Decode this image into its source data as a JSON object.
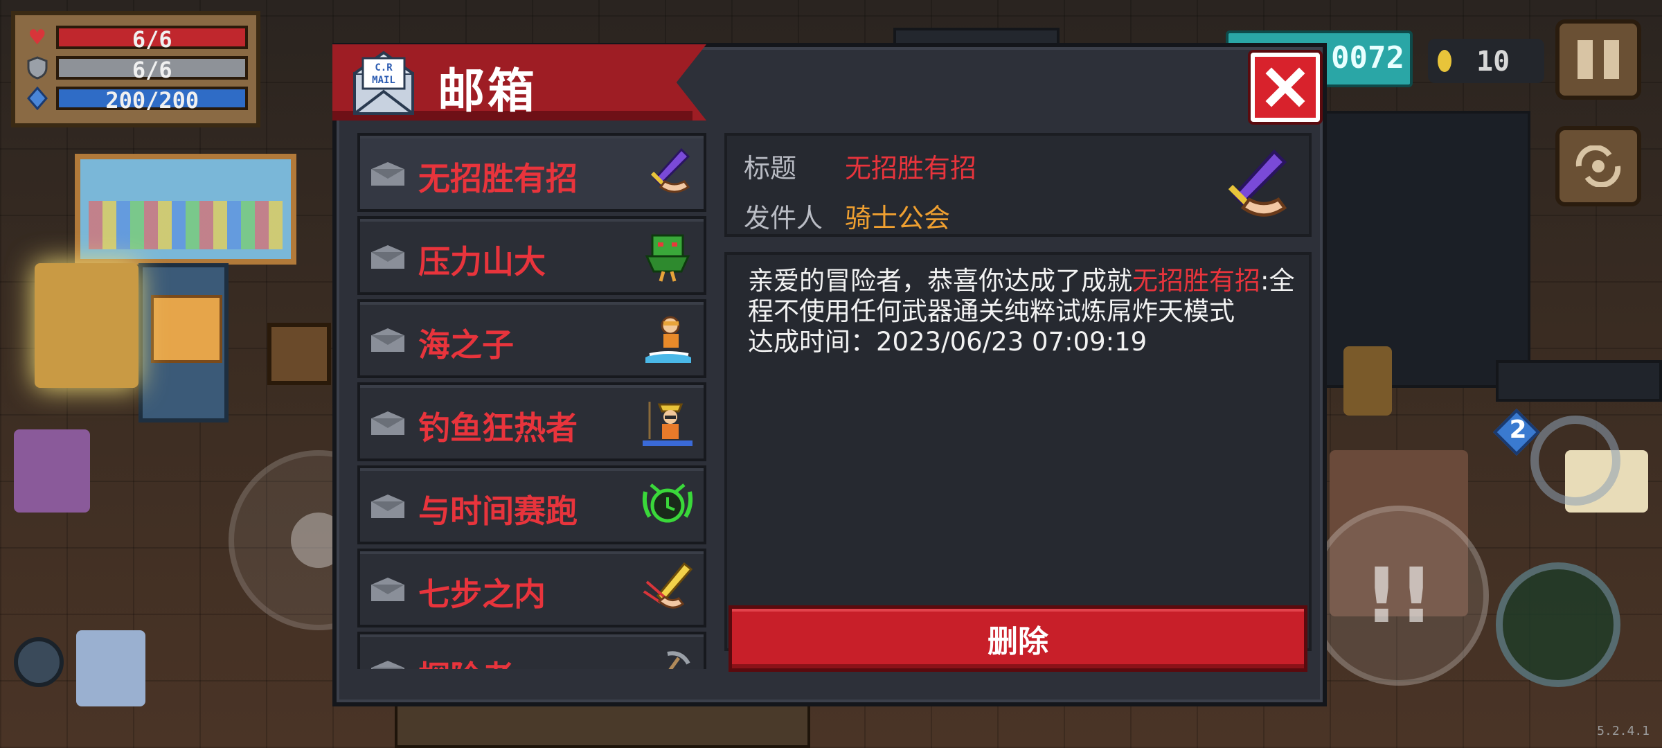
{
  "hud": {
    "hp": "6/6",
    "armor": "6/6",
    "energy": "200/200",
    "gems": "0072",
    "coins": "10",
    "weapon_level": "2",
    "version": "5.2.4.1"
  },
  "mailbox": {
    "title": "邮箱",
    "mail_icon_text": "C.R MAIL",
    "close_label": "✕",
    "items": [
      {
        "label": "无招胜有招",
        "icon": "purple-sword-hand-icon"
      },
      {
        "label": "压力山大",
        "icon": "green-demon-icon"
      },
      {
        "label": "海之子",
        "icon": "surfer-icon"
      },
      {
        "label": "钓鱼狂热者",
        "icon": "fisherman-icon"
      },
      {
        "label": "与时间赛跑",
        "icon": "clock-icon"
      },
      {
        "label": "七步之内",
        "icon": "golden-blade-icon"
      },
      {
        "label": "探险者",
        "icon": "pickaxe-icon"
      }
    ],
    "detail": {
      "subject_key": "标题",
      "subject_value": "无招胜有招",
      "sender_key": "发件人",
      "sender_value": "骑士公会",
      "body_before": "亲爱的冒险者，恭喜你达成了成就",
      "body_highlight": "无招胜有招",
      "body_after": ":全程不使用任何武器通关纯粹试炼屌炸天模式",
      "achieved_label": "达成时间：",
      "achieved_time": "2023/06/23 07:09:19",
      "delete_label": "删除"
    }
  },
  "colors": {
    "accent_red": "#e8343c",
    "sender_orange": "#f0a030",
    "panel_bg": "#2d3039",
    "header_red": "#9e1d24"
  }
}
